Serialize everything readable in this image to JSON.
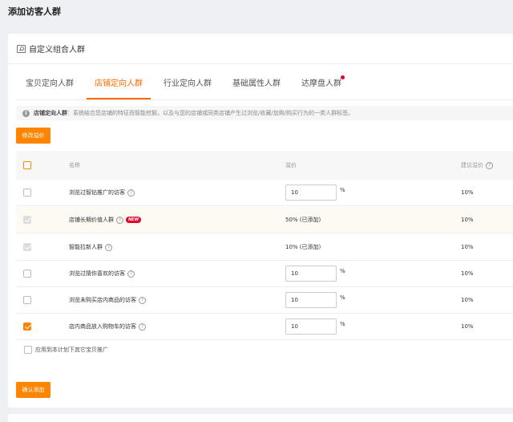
{
  "page": {
    "title": "添加访客人群"
  },
  "card": {
    "header": "自定义组合人群"
  },
  "tabs": [
    {
      "label": "宝贝定向人群",
      "active": false,
      "dot": false
    },
    {
      "label": "店铺定向人群",
      "active": true,
      "dot": false
    },
    {
      "label": "行业定向人群",
      "active": false,
      "dot": false
    },
    {
      "label": "基础属性人群",
      "active": false,
      "dot": false
    },
    {
      "label": "达摩盘人群",
      "active": false,
      "dot": true
    }
  ],
  "info": {
    "title": "店铺定向人群",
    "text": "：系统结合您店铺的特征而智能挖掘，以及与您的店铺或同类店铺产生过浏览/收藏/加购/购买行为的一类人群标签。"
  },
  "buttons": {
    "modify_bid": "修改溢价",
    "confirm_add": "确认添加"
  },
  "table": {
    "headers": {
      "name": "名称",
      "bid": "溢价",
      "suggest": "建议溢价"
    },
    "rows": [
      {
        "name": "浏览过智钻推广的访客",
        "bid_value": "10",
        "bid_unit": "%",
        "suggest": "10%",
        "state": "unchecked",
        "editable": true,
        "is_new": false
      },
      {
        "name": "店铺长期价值人群",
        "bid_text": "50% (已添加)",
        "suggest": "10%",
        "state": "disabled",
        "editable": false,
        "is_new": true,
        "badge": "NEW"
      },
      {
        "name": "智能拉新人群",
        "bid_text": "10% (已添加)",
        "suggest": "10%",
        "state": "disabled",
        "editable": false,
        "is_new": false
      },
      {
        "name": "浏览过猜你喜欢的访客",
        "bid_value": "10",
        "bid_unit": "%",
        "suggest": "10%",
        "state": "unchecked",
        "editable": true,
        "is_new": false
      },
      {
        "name": "浏览未购买店内商品的访客",
        "bid_value": "10",
        "bid_unit": "%",
        "suggest": "10%",
        "state": "unchecked",
        "editable": true,
        "is_new": false
      },
      {
        "name": "店内商品放入购物车的访客",
        "bid_value": "10",
        "bid_unit": "%",
        "suggest": "10%",
        "state": "checked",
        "editable": true,
        "is_new": false
      }
    ]
  },
  "apply_all": {
    "label": "应用到本计划下其它宝贝推广"
  },
  "colors": {
    "accent": "#ff8400",
    "tab_active": "#ff6a00",
    "badge": "#e4002b"
  }
}
